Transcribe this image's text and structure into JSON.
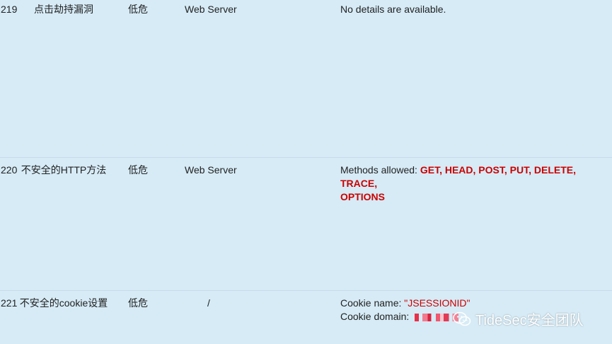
{
  "rows": [
    {
      "id": "219",
      "name": "点击劫持漏洞",
      "severity": "低危",
      "location": "Web Server",
      "detail": "No details are available."
    },
    {
      "id": "220",
      "name": "不安全的HTTP方法",
      "severity": "低危",
      "location": "Web Server",
      "detail_prefix": "Methods allowed: ",
      "detail_methods_1": "GET, HEAD, POST, PUT, DELETE, TRACE,",
      "detail_methods_2": "OPTIONS"
    },
    {
      "id": "221",
      "name": "不安全的cookie设置",
      "severity": "低危",
      "location": "/",
      "cookie_name_label": "Cookie name: ",
      "cookie_name_value": "\"JSESSIONID\"",
      "cookie_domain_label": "Cookie domain: "
    }
  ],
  "watermark": {
    "text": "TideSec安全团队",
    "icon": "wechat-icon"
  },
  "colors": {
    "background": "#d6ebf6",
    "highlight": "#cc0000"
  }
}
